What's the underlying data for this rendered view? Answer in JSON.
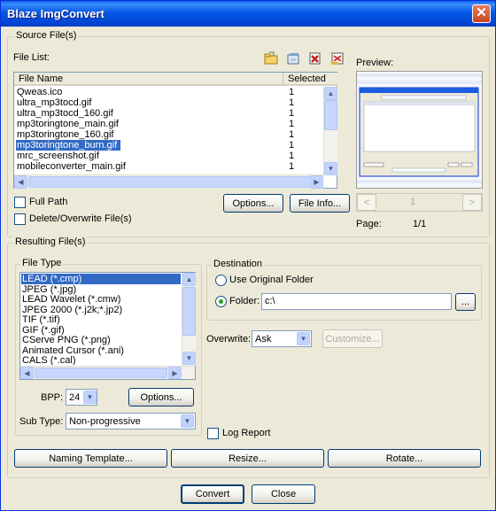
{
  "window": {
    "title": "Blaze ImgConvert"
  },
  "source": {
    "group_label": "Source File(s)",
    "file_list_label": "File List:",
    "columns": [
      "File Name",
      "Selected Pa"
    ],
    "files": [
      {
        "name": "Qweas.ico",
        "selected_page": "1"
      },
      {
        "name": "ultra_mp3tocd.gif",
        "selected_page": "1"
      },
      {
        "name": "ultra_mp3tocd_160.gif",
        "selected_page": "1"
      },
      {
        "name": "mp3toringtone_main.gif",
        "selected_page": "1"
      },
      {
        "name": "mp3toringtone_160.gif",
        "selected_page": "1"
      },
      {
        "name": "mp3toringtone_burn.gif",
        "selected_page": "1"
      },
      {
        "name": "mrc_screenshot.gif",
        "selected_page": "1"
      },
      {
        "name": "mobileconverter_main.gif",
        "selected_page": "1"
      }
    ],
    "selected_index": 5,
    "full_path_label": "Full Path",
    "delete_overwrite_label": "Delete/Overwrite File(s)",
    "options_button": "Options...",
    "file_info_button": "File Info...",
    "toolbar_icons": [
      "add-folder-icon",
      "add-files-icon",
      "remove-file-icon",
      "clear-list-icon"
    ]
  },
  "preview": {
    "label": "Preview:",
    "page_number": "1",
    "page_label": "Page:",
    "page_value": "1/1"
  },
  "result": {
    "group_label": "Resulting File(s)",
    "file_type_label": "File Type",
    "file_types": [
      "LEAD (*.cmp)",
      "JPEG (*.jpg)",
      "LEAD Wavelet (*.cmw)",
      "JPEG 2000 (*.j2k;*.jp2)",
      "TIF (*.tif)",
      "GIF (*.gif)",
      "CServe PNG (*.png)",
      "Animated Cursor (*.ani)",
      "CALS (*.cal)"
    ],
    "file_type_selected": 0,
    "bpp_label": "BPP:",
    "bpp_value": "24",
    "options_button": "Options...",
    "subtype_label": "Sub Type:",
    "subtype_value": "Non-progressive",
    "destination_label": "Destination",
    "use_original_label": "Use Original Folder",
    "folder_label": "Folder:",
    "folder_value": "c:\\",
    "browse_button": "...",
    "overwrite_label": "Overwrite:",
    "overwrite_value": "Ask",
    "customize_button": "Customize...",
    "log_report_label": "Log Report"
  },
  "bottom": {
    "naming_button": "Naming Template...",
    "resize_button": "Resize...",
    "rotate_button": "Rotate...",
    "convert_button": "Convert",
    "close_button": "Close"
  }
}
